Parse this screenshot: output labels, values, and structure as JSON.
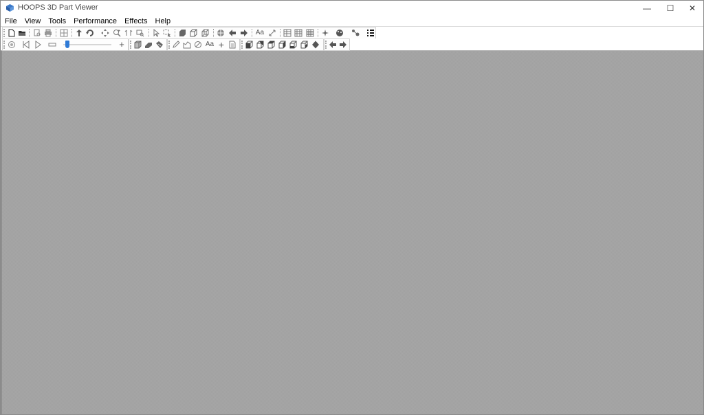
{
  "window": {
    "title": "HOOPS 3D Part Viewer",
    "controls": {
      "minimize": "—",
      "maximize": "☐",
      "close": "✕"
    }
  },
  "menu": [
    "File",
    "View",
    "Tools",
    "Performance",
    "Effects",
    "Help"
  ],
  "toolbar_row1": {
    "buttons": [
      {
        "name": "new-file-icon"
      },
      {
        "name": "open-folder-icon"
      },
      {
        "name": "print-preview-icon"
      },
      {
        "name": "print-icon"
      },
      {
        "name": "grid-layout-icon"
      },
      {
        "name": "orbit-icon"
      },
      {
        "name": "rotate-icon"
      },
      {
        "name": "pan-icon"
      },
      {
        "name": "zoom-icon"
      },
      {
        "name": "zoom-to-window-icon"
      },
      {
        "name": "zoom-extents-icon"
      },
      {
        "name": "select-arrow-icon"
      },
      {
        "name": "select-box-icon"
      },
      {
        "name": "solid-shaded-icon"
      },
      {
        "name": "hidden-line-icon"
      },
      {
        "name": "wireframe-icon"
      },
      {
        "name": "camera-sphere-icon"
      },
      {
        "name": "back-arrow-icon"
      },
      {
        "name": "forward-arrow-icon"
      },
      {
        "name": "text-icon",
        "text": "Aa"
      },
      {
        "name": "measure-icon"
      },
      {
        "name": "table-icon"
      },
      {
        "name": "table-grid-icon"
      },
      {
        "name": "table-large-icon"
      },
      {
        "name": "sparkle-icon"
      },
      {
        "name": "palette-icon"
      },
      {
        "name": "nodes-icon"
      },
      {
        "name": "list-icon"
      }
    ]
  },
  "toolbar_row2": {
    "buttons": [
      {
        "name": "record-icon"
      },
      {
        "name": "skip-back-icon"
      },
      {
        "name": "play-icon"
      },
      {
        "name": "stop-icon"
      },
      {
        "name": "plus-icon",
        "text": "+"
      },
      {
        "name": "cube-corner-icon"
      },
      {
        "name": "eraser-icon"
      },
      {
        "name": "magnet-icon"
      },
      {
        "name": "pencil-icon"
      },
      {
        "name": "polygon-icon"
      },
      {
        "name": "circle-icon"
      },
      {
        "name": "annotate-text-icon",
        "text": "Aa"
      },
      {
        "name": "crosshair-icon",
        "text": "+"
      },
      {
        "name": "page-icon"
      },
      {
        "name": "view-front-icon"
      },
      {
        "name": "view-back-icon"
      },
      {
        "name": "view-left-icon"
      },
      {
        "name": "view-right-icon"
      },
      {
        "name": "view-top-icon"
      },
      {
        "name": "view-bottom-icon"
      },
      {
        "name": "view-iso-icon"
      },
      {
        "name": "step-back-icon"
      },
      {
        "name": "step-forward-icon"
      }
    ],
    "slider_value": 0.05
  },
  "colors": {
    "viewport_bg": "#a6a6a6",
    "slider_accent": "#2f7ad6",
    "icon_dark": "#333333",
    "icon_mid": "#6a6a6a"
  }
}
